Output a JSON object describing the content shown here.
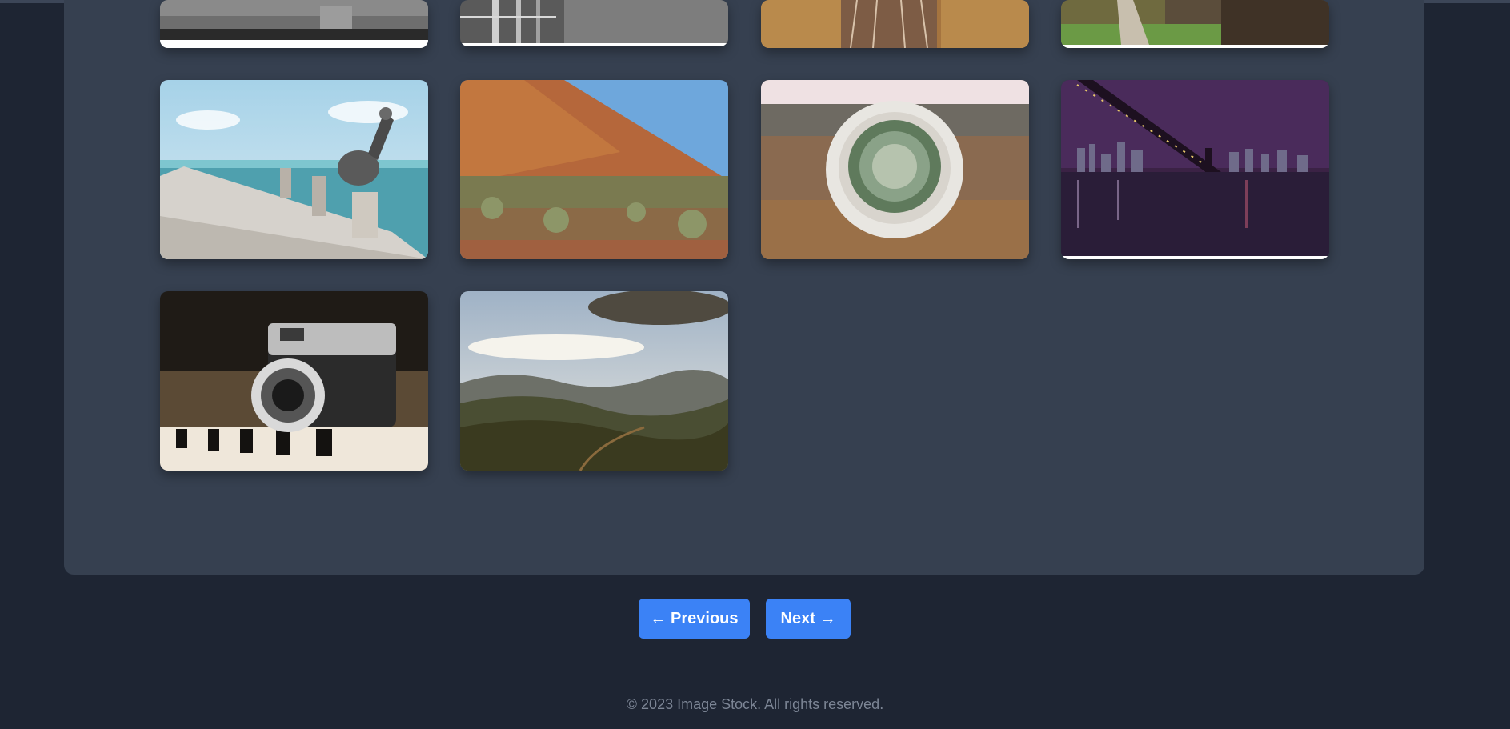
{
  "gallery": {
    "images": [
      {
        "name": "harbor-bw-photo",
        "alt": "black and white harbor"
      },
      {
        "name": "fence-bw-photo",
        "alt": "black and white fence"
      },
      {
        "name": "railway-tracks-photo",
        "alt": "railway tracks"
      },
      {
        "name": "forest-path-photo",
        "alt": "forest path"
      },
      {
        "name": "pelican-pier-photo",
        "alt": "pelican on pier"
      },
      {
        "name": "desert-rock-photo",
        "alt": "desert rock"
      },
      {
        "name": "cactus-pot-photo",
        "alt": "cactus in pot"
      },
      {
        "name": "bridge-night-photo",
        "alt": "bridge at night"
      },
      {
        "name": "vintage-camera-photo",
        "alt": "vintage camera on piano"
      },
      {
        "name": "mountain-valley-photo",
        "alt": "mountain valley"
      }
    ]
  },
  "pagination": {
    "previous_label": "← Previous",
    "next_label": "Next →"
  },
  "footer": {
    "copyright": "© 2023 Image Stock. All rights reserved."
  },
  "colors": {
    "page_bg": "#1e2533",
    "panel_bg": "#364050",
    "button_bg": "#3b82f6",
    "footer_text": "#7c8595"
  }
}
